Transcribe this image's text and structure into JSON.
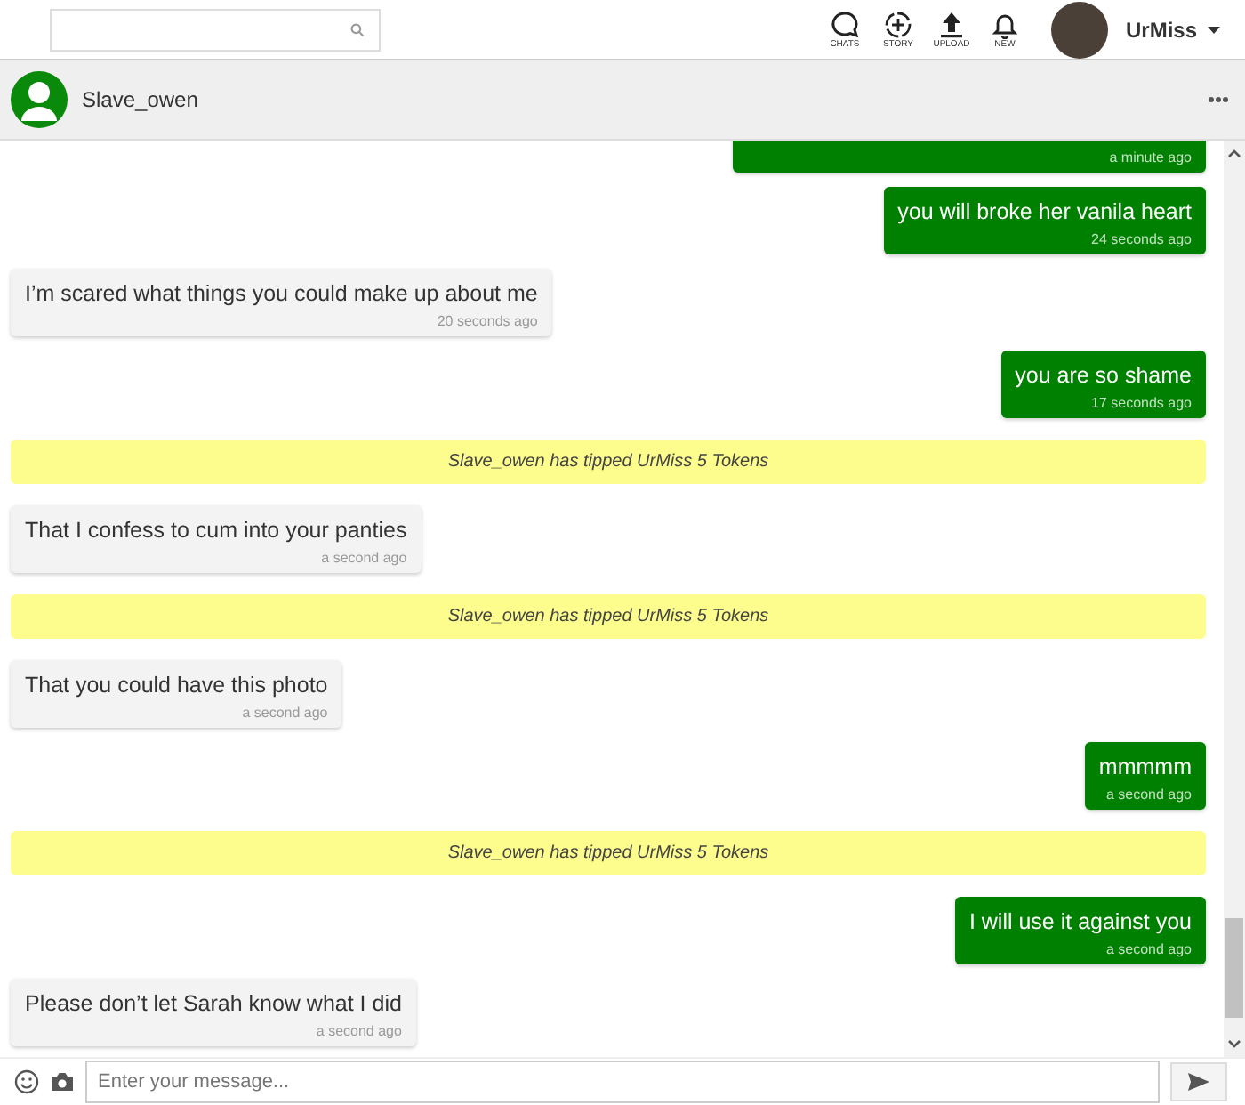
{
  "topbar": {
    "nav": [
      {
        "kind": "chats",
        "label": "CHATS"
      },
      {
        "kind": "story",
        "label": "STORY"
      },
      {
        "kind": "upload",
        "label": "UPLOAD"
      },
      {
        "kind": "new",
        "label": "NEW"
      }
    ],
    "user": {
      "name": "UrMiss"
    }
  },
  "chat_header": {
    "name": "Slave_owen"
  },
  "messages": [
    {
      "kind": "sent",
      "time": "a minute ago"
    },
    {
      "kind": "sent",
      "text": "you will broke her vanila heart",
      "time": "24 seconds ago"
    },
    {
      "kind": "received",
      "text": "I’m scared what things you could make up about me",
      "time": "20 seconds ago"
    },
    {
      "kind": "sent",
      "text": "you are so shame",
      "time": "17 seconds ago"
    },
    {
      "kind": "tip",
      "text": "Slave_owen has tipped UrMiss 5 Tokens"
    },
    {
      "kind": "received",
      "text": "That I confess to cum into your panties",
      "time": "a second ago"
    },
    {
      "kind": "tip",
      "text": "Slave_owen has tipped UrMiss 5 Tokens"
    },
    {
      "kind": "received",
      "text": "That you could have this photo",
      "time": "a second ago"
    },
    {
      "kind": "sent",
      "text": "mmmmm",
      "time": "a second ago"
    },
    {
      "kind": "tip",
      "text": "Slave_owen has tipped UrMiss 5 Tokens"
    },
    {
      "kind": "sent",
      "text": "I will use it against you",
      "time": "a second ago"
    },
    {
      "kind": "received",
      "text": "Please don’t let Sarah know what I did",
      "time": "a second ago"
    }
  ],
  "composer": {
    "placeholder": "Enter your message..."
  }
}
